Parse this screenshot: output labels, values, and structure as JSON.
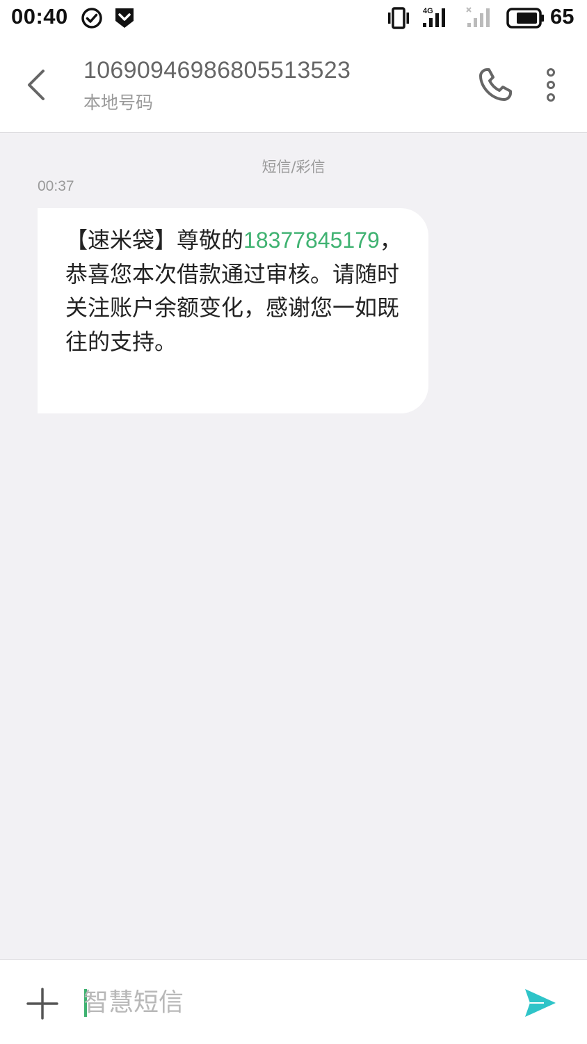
{
  "status_bar": {
    "time": "00:40",
    "battery_percent": "65",
    "network_label": "4G"
  },
  "header": {
    "contact_number": "10690946986805513523",
    "contact_sub": "本地号码"
  },
  "conversation": {
    "channel_label": "短信/彩信",
    "message_time": "00:37",
    "message": {
      "prefix": "【速米袋】尊敬的",
      "phone": "18377845179",
      "suffix": "，恭喜您本次借款通过审核。请随时关注账户余额变化，感谢您一如既往的支持。"
    }
  },
  "input_bar": {
    "placeholder": "智慧短信"
  },
  "colors": {
    "accent_green": "#3fb271",
    "send_teal": "#2ec4c8"
  }
}
